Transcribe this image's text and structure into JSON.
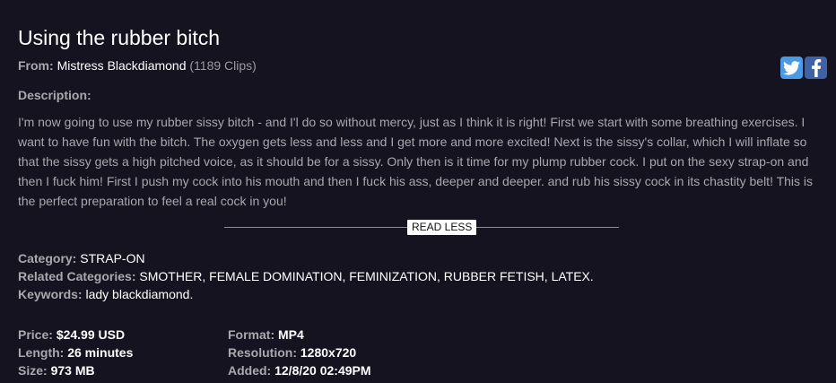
{
  "title": "Using the rubber bitch",
  "from": {
    "label": "From:",
    "author": "Mistress Blackdiamond",
    "clips": "(1189 Clips)"
  },
  "social": {
    "twitter_icon": "twitter-icon",
    "facebook_icon": "facebook-icon"
  },
  "description": {
    "label": "Description:",
    "text": "I'm now going to use my rubber sissy bitch - and I'l do so without mercy, just as I think it is right! First we start with some breathing exercises. I want to have fun with the bitch. The oxygen gets less and less and I get more and more excited! Next is the sissy's collar, which I will inflate so that the sissy gets a high pitched voice, as it should be for a sissy. Only then is it time for my plump rubber cock. I put on the sexy strap-on and then I fuck him! First I push my cock into his mouth and then I fuck his ass, deeper and deeper. and rub his sissy cock in its chastity belt! This is the perfect preparation to feel a real cock in you!",
    "toggle": "READ LESS"
  },
  "category": {
    "label": "Category:",
    "value": "STRAP-ON"
  },
  "related": {
    "label": "Related Categories:",
    "items": [
      "SMOTHER",
      "FEMALE DOMINATION",
      "FEMINIZATION",
      "RUBBER FETISH",
      "LATEX"
    ]
  },
  "keywords": {
    "label": "Keywords:",
    "value": "lady blackdiamond"
  },
  "specs": {
    "price": {
      "label": "Price:",
      "value": "$24.99 USD"
    },
    "length": {
      "label": "Length:",
      "value": "26 minutes"
    },
    "size": {
      "label": "Size:",
      "value": "973 MB"
    },
    "format": {
      "label": "Format:",
      "value": "MP4"
    },
    "resolution": {
      "label": "Resolution:",
      "value": "1280x720"
    },
    "added": {
      "label": "Added:",
      "value": "12/8/20 02:49PM"
    }
  }
}
